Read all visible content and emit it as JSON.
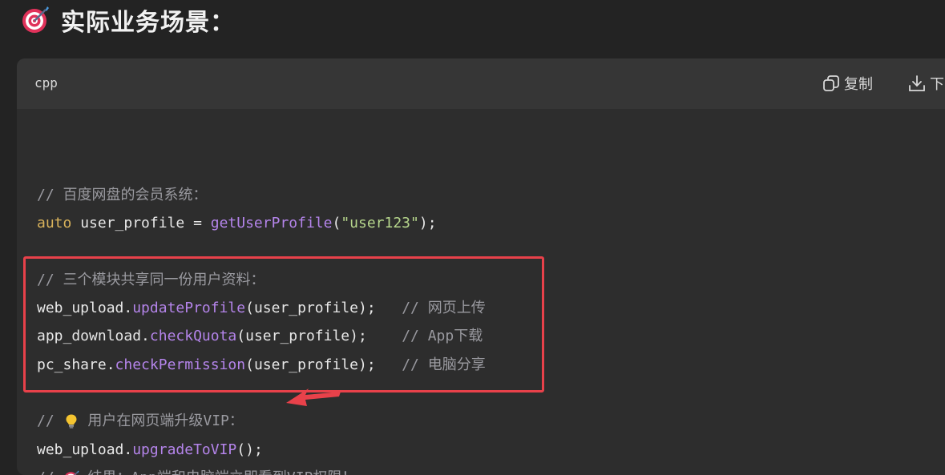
{
  "heading": {
    "title": "实际业务场景："
  },
  "code_block": {
    "language": "cpp",
    "copy_label": "复制",
    "download_label": "下",
    "lines": [
      {
        "comment": "// 百度网盘的会员系统："
      },
      {
        "kw": "auto",
        "rest1": " user_profile = ",
        "fn": "getUserProfile",
        "p1": "(",
        "str": "\"user123\"",
        "p2": ");"
      },
      {
        "comment": "// 三个模块共享同一份用户资料："
      },
      {
        "obj": "web_upload.",
        "fn": "updateProfile",
        "args": "(user_profile);",
        "pad": "   ",
        "comment": "// 网页上传"
      },
      {
        "obj": "app_download.",
        "fn": "checkQuota",
        "args": "(user_profile);",
        "pad": "    ",
        "comment": "// App下载"
      },
      {
        "obj": "pc_share.",
        "fn": "checkPermission",
        "args": "(user_profile);",
        "pad": "   ",
        "comment": "// 电脑分享"
      },
      {
        "pre": "// ",
        "post": " 用户在网页端升级VIP："
      },
      {
        "obj": "web_upload.",
        "fn": "upgradeToVIP",
        "args": "();"
      },
      {
        "pre": "// ",
        "post": " 结果：App端和电脑端立即看到VIP权限！"
      }
    ]
  },
  "colors": {
    "highlight_border": "#e8414a",
    "comment": "#9a9aa0",
    "keyword": "#d8b25b",
    "function": "#b484ea",
    "string": "#b6d68c"
  }
}
